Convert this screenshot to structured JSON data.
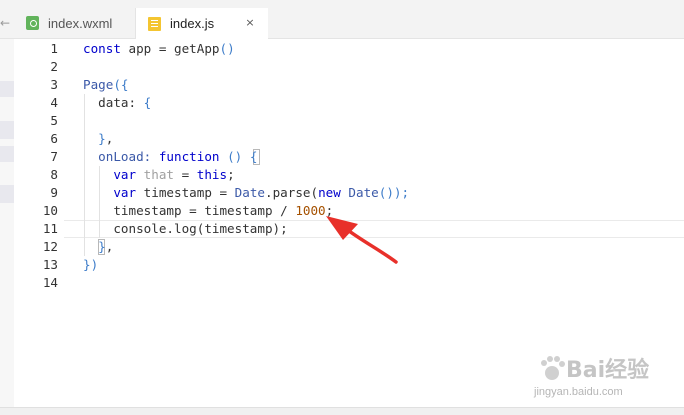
{
  "tabs": [
    {
      "label": "index.wxml",
      "icon": "wxml-file-icon",
      "active": false
    },
    {
      "label": "index.js",
      "icon": "js-file-icon",
      "active": true
    }
  ],
  "close_glyph": "×",
  "back_glyph": "←",
  "line_numbers": [
    "1",
    "2",
    "3",
    "4",
    "5",
    "6",
    "7",
    "8",
    "9",
    "10",
    "11",
    "12",
    "13",
    "14"
  ],
  "code": {
    "l1": {
      "a": "const",
      "b": " app = ",
      "c": "getApp",
      "d": "()"
    },
    "l3": {
      "a": "Page",
      "b": "({"
    },
    "l4": {
      "a": "  data: ",
      "b": "{"
    },
    "l6": {
      "a": "  }",
      "b": ","
    },
    "l7": {
      "a": "  onLoad: ",
      "b": "function",
      "c": " () ",
      "d": "{"
    },
    "l8": {
      "a": "    ",
      "b": "var",
      "c": " that",
      "d": " = ",
      "e": "this",
      "f": ";"
    },
    "l9": {
      "a": "    ",
      "b": "var",
      "c": " timestamp = ",
      "d": "Date",
      "e": ".parse(",
      "f": "new",
      "g": " Date",
      "h": "());"
    },
    "l10": {
      "a": "    timestamp = timestamp / ",
      "b": "1000",
      "c": ";"
    },
    "l11": {
      "a": "    console.log(timestamp);"
    },
    "l12": {
      "a": "  }",
      "b": ","
    },
    "l13": {
      "a": "})"
    }
  },
  "watermark": {
    "brand": "Bai",
    "brand2": "经验",
    "url": "jingyan.baidu.com"
  },
  "colors": {
    "annotation_arrow": "#e8302a",
    "keyword": "#0000cc",
    "number": "#a55100"
  }
}
